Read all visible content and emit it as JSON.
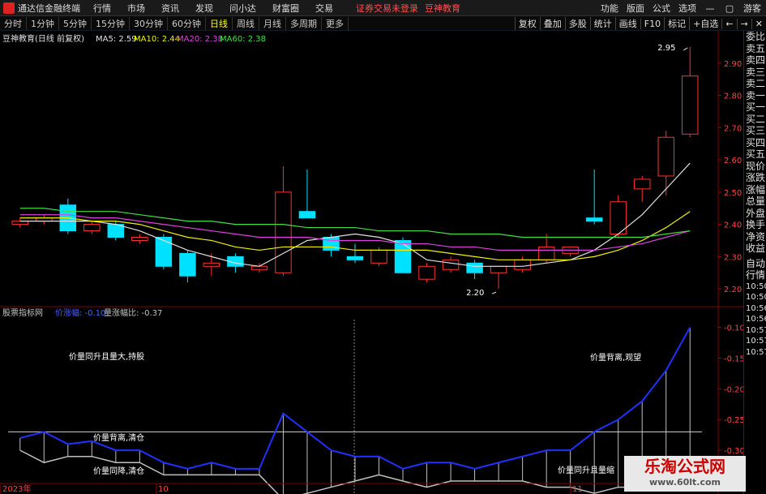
{
  "app": {
    "title": "通达信金融终端",
    "menus": [
      "行情",
      "市场",
      "资讯",
      "发现",
      "问小达",
      "财富圈",
      "交易"
    ],
    "status": "证券交易未登录",
    "brand": "豆神教育",
    "right_menus": [
      "功能",
      "版面",
      "公式",
      "选项"
    ],
    "guest": "游客"
  },
  "periods": [
    "分时",
    "1分钟",
    "5分钟",
    "15分钟",
    "30分钟",
    "60分钟",
    "日线",
    "周线",
    "月线",
    "多周期",
    "更多"
  ],
  "active_period": "日线",
  "tools": [
    "复权",
    "叠加",
    "多股",
    "统计",
    "画线",
    "F10",
    "标记",
    "+自选"
  ],
  "window_controls": [
    "←",
    "→",
    "✕"
  ],
  "main_header": {
    "stock": "豆神教育(日线 前复权)",
    "ma": [
      {
        "label": "MA5: 2.59",
        "color": "#e0e0e0"
      },
      {
        "label": "MA10: 2.44",
        "color": "#f0f000"
      },
      {
        "label": "MA20: 2.38",
        "color": "#e040e0"
      },
      {
        "label": "MA60: 2.38",
        "color": "#40e040"
      }
    ]
  },
  "sub_header": {
    "name": "股票指标网",
    "line1": "价涨幅: -0.10",
    "line1_color": "#4060ff",
    "line2": "量涨幅比: -0.37",
    "line2_color": "#c0c0c0"
  },
  "right_panel": {
    "items": [
      "委比",
      "卖五",
      "卖四",
      "卖三",
      "卖二",
      "卖一",
      "买一",
      "买二",
      "买三",
      "买四",
      "买五",
      "现价",
      "涨跌",
      "涨幅",
      "总量",
      "外盘",
      "换手",
      "净资",
      "收益"
    ],
    "items2": [
      "自动",
      "行情"
    ],
    "times": [
      "10:50",
      "10:50",
      "10:56",
      "10:56",
      "10:57",
      "10:57",
      "10:57"
    ]
  },
  "watermark": {
    "title": "乐淘公式网",
    "url": "www.60lt.com"
  },
  "chart_data": [
    {
      "type": "candlestick",
      "title": "豆神教育(日线 前复权)",
      "ylim": [
        2.15,
        2.98
      ],
      "yticks": [
        2.2,
        2.3,
        2.4,
        2.5,
        2.6,
        2.7,
        2.8,
        2.9
      ],
      "candles": [
        {
          "o": 2.4,
          "h": 2.42,
          "l": 2.39,
          "c": 2.41
        },
        {
          "o": 2.41,
          "h": 2.43,
          "l": 2.4,
          "c": 2.42
        },
        {
          "o": 2.46,
          "h": 2.48,
          "l": 2.37,
          "c": 2.38
        },
        {
          "o": 2.38,
          "h": 2.41,
          "l": 2.37,
          "c": 2.4
        },
        {
          "o": 2.4,
          "h": 2.41,
          "l": 2.35,
          "c": 2.36
        },
        {
          "o": 2.35,
          "h": 2.37,
          "l": 2.34,
          "c": 2.36
        },
        {
          "o": 2.36,
          "h": 2.37,
          "l": 2.26,
          "c": 2.27
        },
        {
          "o": 2.31,
          "h": 2.32,
          "l": 2.22,
          "c": 2.24
        },
        {
          "o": 2.27,
          "h": 2.31,
          "l": 2.24,
          "c": 2.28
        },
        {
          "o": 2.3,
          "h": 2.31,
          "l": 2.25,
          "c": 2.27
        },
        {
          "o": 2.26,
          "h": 2.28,
          "l": 2.25,
          "c": 2.27
        },
        {
          "o": 2.25,
          "h": 2.58,
          "l": 2.24,
          "c": 2.5
        },
        {
          "o": 2.44,
          "h": 2.57,
          "l": 2.42,
          "c": 2.42
        },
        {
          "o": 2.36,
          "h": 2.37,
          "l": 2.3,
          "c": 2.32
        },
        {
          "o": 2.3,
          "h": 2.34,
          "l": 2.28,
          "c": 2.29
        },
        {
          "o": 2.28,
          "h": 2.33,
          "l": 2.27,
          "c": 2.32
        },
        {
          "o": 2.35,
          "h": 2.36,
          "l": 2.25,
          "c": 2.25
        },
        {
          "o": 2.23,
          "h": 2.28,
          "l": 2.22,
          "c": 2.27
        },
        {
          "o": 2.26,
          "h": 2.3,
          "l": 2.25,
          "c": 2.29
        },
        {
          "o": 2.28,
          "h": 2.29,
          "l": 2.23,
          "c": 2.25
        },
        {
          "o": 2.25,
          "h": 2.27,
          "l": 2.2,
          "c": 2.27
        },
        {
          "o": 2.26,
          "h": 2.3,
          "l": 2.25,
          "c": 2.29
        },
        {
          "o": 2.29,
          "h": 2.37,
          "l": 2.28,
          "c": 2.33
        },
        {
          "o": 2.31,
          "h": 2.33,
          "l": 2.3,
          "c": 2.33
        },
        {
          "o": 2.42,
          "h": 2.57,
          "l": 2.4,
          "c": 2.41
        },
        {
          "o": 2.37,
          "h": 2.49,
          "l": 2.36,
          "c": 2.47
        },
        {
          "o": 2.51,
          "h": 2.55,
          "l": 2.47,
          "c": 2.54
        },
        {
          "o": 2.55,
          "h": 2.69,
          "l": 2.49,
          "c": 2.67
        },
        {
          "o": 2.68,
          "h": 2.95,
          "l": 2.67,
          "c": 2.86
        }
      ],
      "series": [
        {
          "name": "MA5",
          "color": "#e0e0e0",
          "values": [
            2.41,
            2.41,
            2.41,
            2.41,
            2.4,
            2.38,
            2.35,
            2.32,
            2.3,
            2.28,
            2.27,
            2.31,
            2.35,
            2.36,
            2.37,
            2.36,
            2.34,
            2.29,
            2.28,
            2.27,
            2.27,
            2.27,
            2.28,
            2.29,
            2.32,
            2.37,
            2.43,
            2.51,
            2.59
          ]
        },
        {
          "name": "MA10",
          "color": "#f0f000",
          "values": [
            2.42,
            2.42,
            2.42,
            2.41,
            2.41,
            2.4,
            2.38,
            2.36,
            2.35,
            2.33,
            2.32,
            2.33,
            2.33,
            2.33,
            2.32,
            2.32,
            2.32,
            2.32,
            2.31,
            2.3,
            2.29,
            2.29,
            2.29,
            2.29,
            2.3,
            2.32,
            2.35,
            2.39,
            2.44
          ]
        },
        {
          "name": "MA20",
          "color": "#e040e0",
          "values": [
            2.43,
            2.43,
            2.43,
            2.42,
            2.42,
            2.41,
            2.4,
            2.39,
            2.38,
            2.37,
            2.36,
            2.36,
            2.36,
            2.35,
            2.35,
            2.35,
            2.34,
            2.34,
            2.33,
            2.33,
            2.32,
            2.32,
            2.32,
            2.32,
            2.32,
            2.33,
            2.34,
            2.36,
            2.38
          ]
        },
        {
          "name": "MA60",
          "color": "#40e040",
          "values": [
            2.45,
            2.45,
            2.44,
            2.44,
            2.44,
            2.43,
            2.42,
            2.41,
            2.41,
            2.4,
            2.4,
            2.4,
            2.39,
            2.39,
            2.39,
            2.38,
            2.38,
            2.38,
            2.37,
            2.37,
            2.37,
            2.36,
            2.36,
            2.36,
            2.36,
            2.36,
            2.36,
            2.37,
            2.38
          ]
        }
      ],
      "annotations": [
        {
          "text": "2.95",
          "index": 28,
          "y": 2.95
        },
        {
          "text": "2.20",
          "index": 20,
          "y": 2.2
        }
      ]
    },
    {
      "type": "line",
      "title": "股票指标网",
      "ylim": [
        -0.35,
        -0.09
      ],
      "yticks": [
        -0.1,
        -0.15,
        -0.2,
        -0.25,
        -0.3,
        -0.35
      ],
      "hline": -0.27,
      "series": [
        {
          "name": "价涨幅",
          "color": "#2030ff",
          "values": [
            -0.28,
            -0.27,
            -0.29,
            -0.285,
            -0.3,
            -0.3,
            -0.32,
            -0.33,
            -0.32,
            -0.33,
            -0.33,
            -0.24,
            -0.27,
            -0.3,
            -0.31,
            -0.31,
            -0.33,
            -0.32,
            -0.32,
            -0.33,
            -0.32,
            -0.31,
            -0.3,
            -0.3,
            -0.27,
            -0.25,
            -0.22,
            -0.17,
            -0.1
          ]
        },
        {
          "name": "量涨幅比",
          "color": "#c0c0c0",
          "values": [
            -0.3,
            -0.32,
            -0.31,
            -0.31,
            -0.32,
            -0.32,
            -0.34,
            -0.34,
            -0.34,
            -0.34,
            -0.34,
            -0.38,
            -0.37,
            -0.36,
            -0.35,
            -0.34,
            -0.35,
            -0.36,
            -0.35,
            -0.35,
            -0.35,
            -0.35,
            -0.36,
            -0.36,
            -0.37,
            -0.36,
            -0.36,
            -0.35,
            -0.34
          ]
        }
      ],
      "annotations": [
        {
          "text": "价量同升且量大,持股",
          "index": 2
        },
        {
          "text": "价量背离,清仓",
          "index": 3
        },
        {
          "text": "价量同降,清仓",
          "index": 3
        },
        {
          "text": "价量背离,观望",
          "index": 23
        },
        {
          "text": "价量同升且量缩",
          "index": 22
        }
      ],
      "x_labels": [
        "2023年",
        "10",
        "11"
      ]
    }
  ]
}
